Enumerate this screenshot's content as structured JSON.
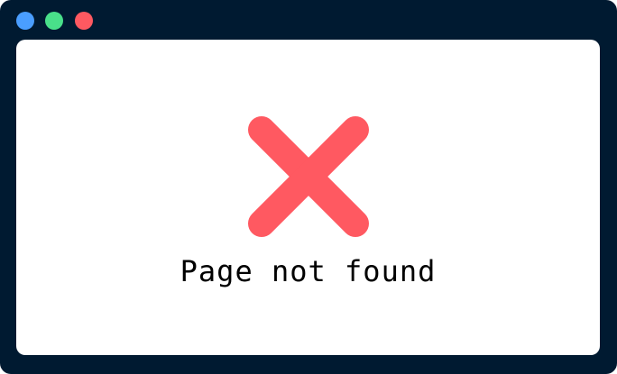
{
  "window": {
    "frame_color": "#001a31",
    "content_color": "#ffffff",
    "controls": [
      {
        "name": "blue-dot",
        "color": "#4a9eff"
      },
      {
        "name": "green-dot",
        "color": "#49e08a"
      },
      {
        "name": "red-dot",
        "color": "#ff5961"
      }
    ]
  },
  "main": {
    "icon": "x-mark-icon",
    "icon_color": "#ff5961",
    "message": "Page not found"
  }
}
